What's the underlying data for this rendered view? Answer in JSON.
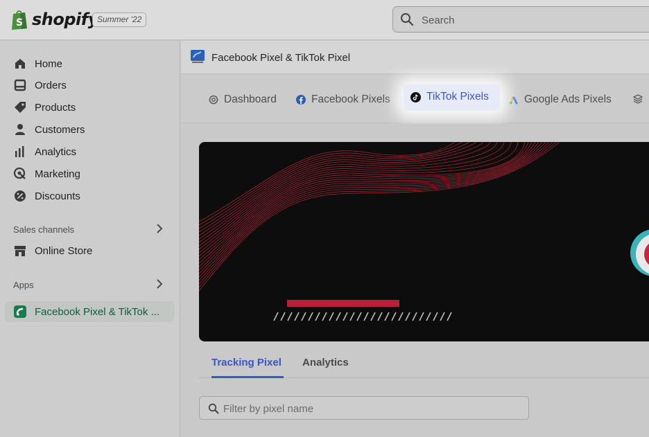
{
  "topbar": {
    "brand": "shopify",
    "edition": "Summer '22",
    "search_placeholder": "Search"
  },
  "sidebar": {
    "items": [
      {
        "label": "Home",
        "icon": "home-icon"
      },
      {
        "label": "Orders",
        "icon": "orders-icon"
      },
      {
        "label": "Products",
        "icon": "tag-icon"
      },
      {
        "label": "Customers",
        "icon": "person-icon"
      },
      {
        "label": "Analytics",
        "icon": "bar-chart-icon"
      },
      {
        "label": "Marketing",
        "icon": "target-icon"
      },
      {
        "label": "Discounts",
        "icon": "percent-icon"
      }
    ],
    "sales_channels_label": "Sales channels",
    "online_store_label": "Online Store",
    "apps_label": "Apps",
    "active_app_label": "Facebook Pixel & TikTok ..."
  },
  "header": {
    "app_title": "Facebook Pixel & TikTok Pixel"
  },
  "tabs": {
    "dashboard": "Dashboard",
    "facebook": "Facebook Pixels",
    "tiktok": "TikTok Pixels",
    "google": "Google Ads Pixels"
  },
  "subtabs": {
    "tracking": "Tracking Pixel",
    "analytics": "Analytics"
  },
  "filter": {
    "placeholder": "Filter by pixel name"
  },
  "colors": {
    "accent": "#3a55c8",
    "active_app": "#0f5b3e",
    "banner_wave": "#c0283f"
  }
}
